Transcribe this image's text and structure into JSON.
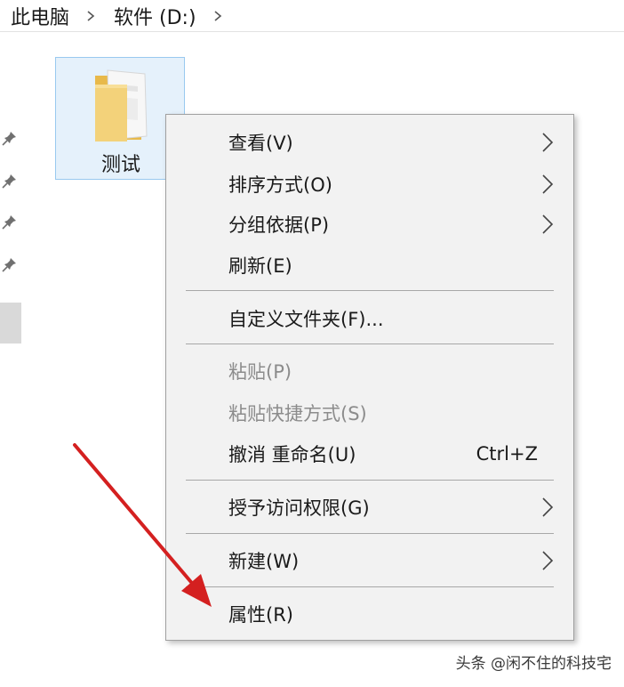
{
  "breadcrumb": {
    "items": [
      "此电脑",
      "软件 (D:)"
    ]
  },
  "folder": {
    "name": "测试",
    "color": "#f3d27a"
  },
  "context_menu": {
    "items": [
      {
        "label": "查看(V)",
        "submenu": true,
        "disabled": false
      },
      {
        "label": "排序方式(O)",
        "submenu": true,
        "disabled": false
      },
      {
        "label": "分组依据(P)",
        "submenu": true,
        "disabled": false
      },
      {
        "label": "刷新(E)",
        "submenu": false,
        "disabled": false
      },
      {
        "label": "自定义文件夹(F)...",
        "submenu": false,
        "disabled": false
      },
      {
        "label": "粘贴(P)",
        "submenu": false,
        "disabled": true
      },
      {
        "label": "粘贴快捷方式(S)",
        "submenu": false,
        "disabled": true
      },
      {
        "label": "撤消 重命名(U)",
        "shortcut": "Ctrl+Z",
        "submenu": false,
        "disabled": false
      },
      {
        "label": "授予访问权限(G)",
        "submenu": true,
        "disabled": false
      },
      {
        "label": "新建(W)",
        "submenu": true,
        "disabled": false
      },
      {
        "label": "属性(R)",
        "submenu": false,
        "disabled": false
      }
    ]
  },
  "annotation": {
    "arrow_color": "#d42020"
  },
  "watermark": "头条 @闲不住的科技宅"
}
